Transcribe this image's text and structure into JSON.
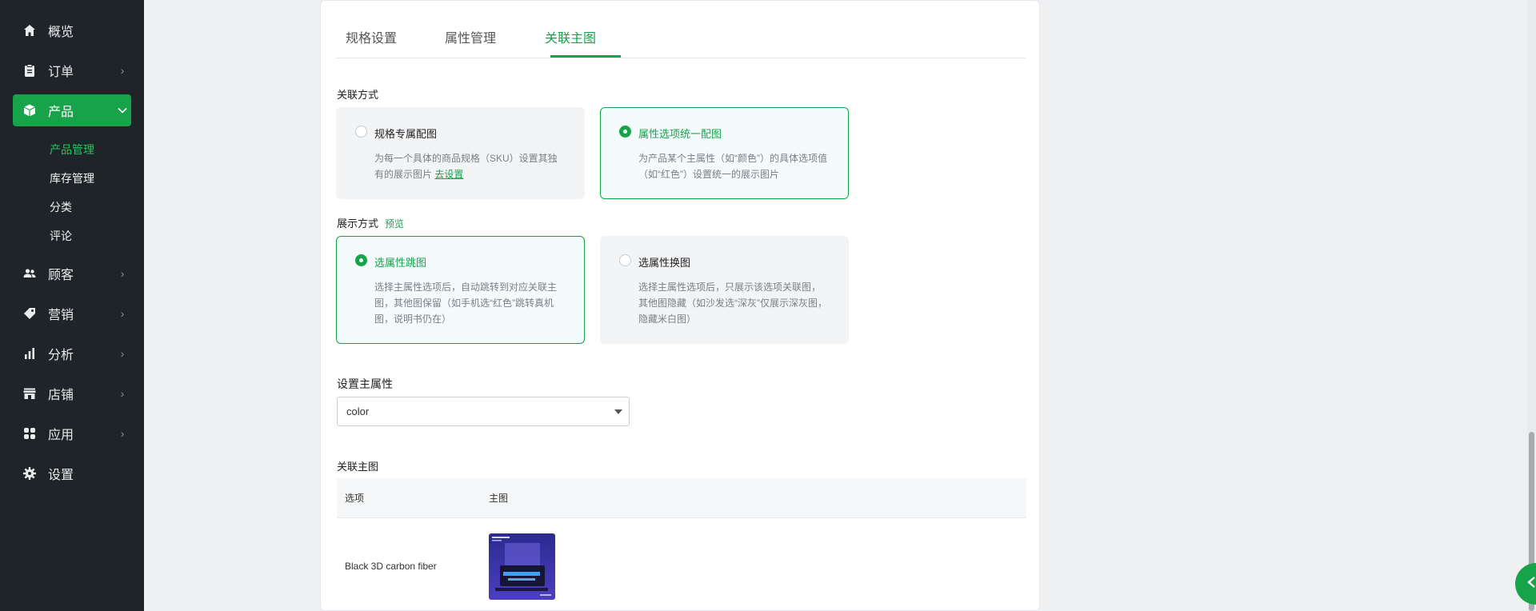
{
  "sidebar": {
    "items": [
      {
        "label": "概览",
        "icon": "home-icon"
      },
      {
        "label": "订单",
        "icon": "clipboard-icon"
      },
      {
        "label": "产品",
        "icon": "box-icon"
      },
      {
        "label": "顾客",
        "icon": "users-icon"
      },
      {
        "label": "营销",
        "icon": "tag-icon"
      },
      {
        "label": "分析",
        "icon": "bar-chart-icon"
      },
      {
        "label": "店铺",
        "icon": "store-icon"
      },
      {
        "label": "应用",
        "icon": "apps-icon"
      },
      {
        "label": "设置",
        "icon": "gear-icon"
      }
    ],
    "sub_items": [
      "产品管理",
      "库存管理",
      "分类",
      "评论"
    ],
    "active_item": "产品",
    "active_sub_item": "产品管理"
  },
  "tabs": [
    "规格设置",
    "属性管理",
    "关联主图"
  ],
  "active_tab": "关联主图",
  "link_mode": {
    "title": "关联方式",
    "options": [
      {
        "title": "规格专属配图",
        "desc": "为每一个具体的商品规格（SKU）设置其独有的展示图片",
        "link": "去设置",
        "selected": false
      },
      {
        "title": "属性选项统一配图",
        "desc": "为产品某个主属性（如“颜色”）的具体选项值（如“红色”）设置统一的展示图片",
        "selected": true
      }
    ]
  },
  "display_mode": {
    "title": "展示方式",
    "preview": "预览",
    "options": [
      {
        "title": "选属性跳图",
        "desc": "选择主属性选项后，自动跳转到对应关联主图，其他图保留（如手机选“红色”跳转真机图，说明书仍在）",
        "selected": true
      },
      {
        "title": "选属性换图",
        "desc": "选择主属性选项后，只展示该选项关联图，其他图隐藏（如沙发选“深灰”仅展示深灰图，隐藏米白图）",
        "selected": false
      }
    ]
  },
  "main_attribute": {
    "title": "设置主属性",
    "value": "color"
  },
  "linked_images": {
    "title": "关联主图",
    "columns": [
      "选项",
      "主图"
    ],
    "rows": [
      {
        "option": "Black 3D carbon fiber",
        "image": "product-thumbnail"
      }
    ]
  },
  "colors": {
    "accent": "#17a34a",
    "sidebar_bg": "#1f2429",
    "page_bg": "#eef0f2"
  }
}
